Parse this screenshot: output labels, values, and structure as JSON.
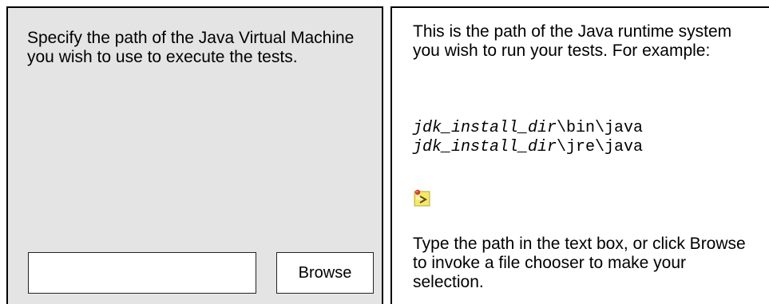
{
  "left_panel": {
    "instructions": "Specify the path of the Java Virtual Machine you wish to use to execute the tests.",
    "path_input": {
      "value": "",
      "placeholder": ""
    },
    "browse_label": "Browse"
  },
  "right_panel": {
    "intro": "This is the path of the Java runtime system you wish to run your tests. For example:",
    "examples": [
      {
        "var": "jdk_install_dir",
        "suffix": "\\bin\\java"
      },
      {
        "var": "jdk_install_dir",
        "suffix": "\\jre\\java"
      }
    ],
    "note_icon": "note-icon",
    "footer": "Type the path in the text box, or click Browse to invoke a file chooser to make your selection."
  },
  "colors": {
    "left_panel_bg": "#e4e4e4",
    "right_panel_bg": "#ffffff",
    "border": "#000000",
    "note_icon_yellow": "#f4e86a",
    "note_icon_red": "#d83a2a"
  }
}
